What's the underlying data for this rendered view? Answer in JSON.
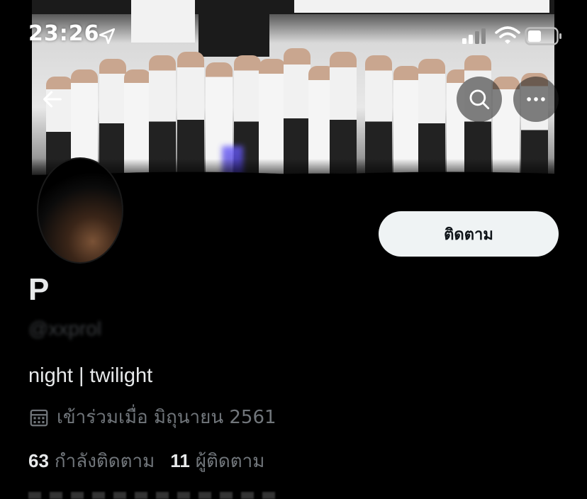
{
  "status_bar": {
    "time": "23:26",
    "icons": [
      "location-arrow-icon",
      "signal-icon",
      "wifi-icon",
      "battery-icon"
    ]
  },
  "header": {
    "back_icon": "arrow-left-icon",
    "search_icon": "search-icon",
    "more_icon": "more-horizontal-icon"
  },
  "profile": {
    "follow_label": "ติดตาม",
    "display_name": "P",
    "handle": "@xxprol",
    "bio": "night | twilight",
    "joined_icon": "calendar-icon",
    "joined": "เข้าร่วมเมื่อ มิถุนายน 2561",
    "following_count": "63",
    "following_label": "กำลังติดตาม",
    "followers_count": "11",
    "followers_label": "ผู้ติดตาม"
  },
  "colors": {
    "background": "#000000",
    "text_primary": "#e7e9ea",
    "text_secondary": "#71767b",
    "follow_button_bg": "#eff3f4"
  }
}
